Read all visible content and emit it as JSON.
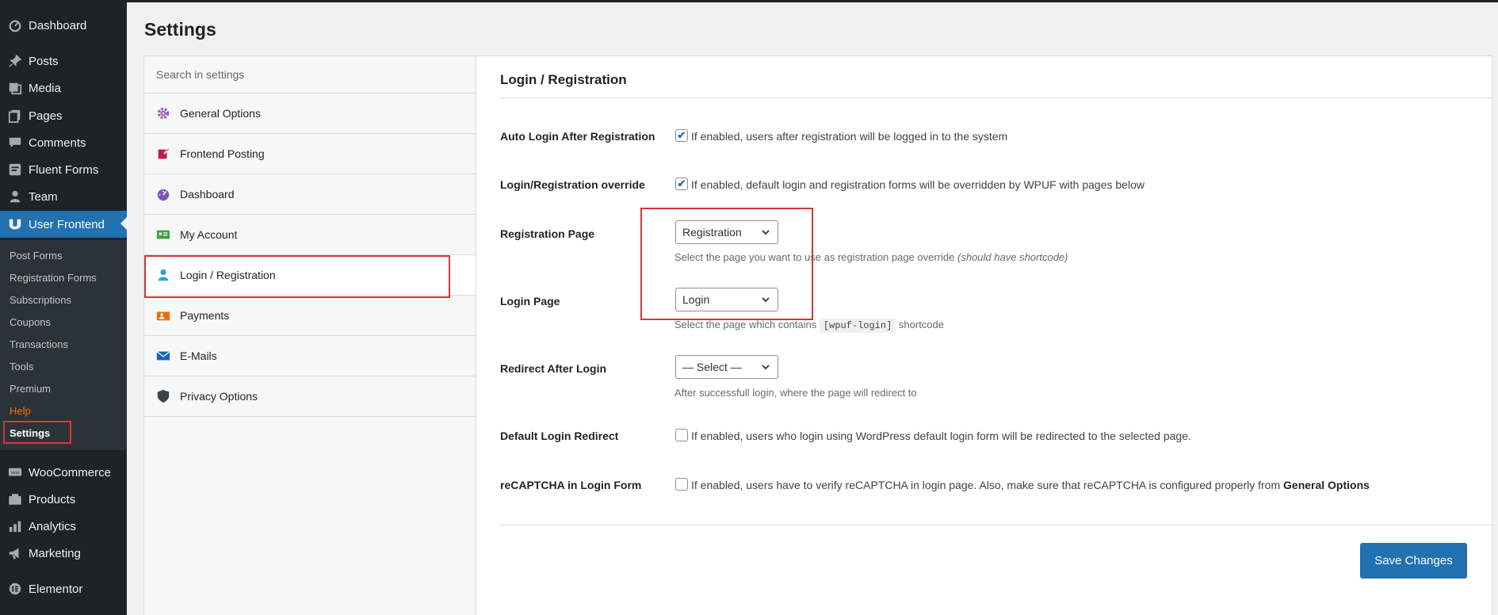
{
  "admin_menu": {
    "items": [
      {
        "label": "Dashboard",
        "icon": "dashboard-icon"
      },
      {
        "label": "Posts",
        "icon": "pin-icon"
      },
      {
        "label": "Media",
        "icon": "media-icon"
      },
      {
        "label": "Pages",
        "icon": "pages-icon"
      },
      {
        "label": "Comments",
        "icon": "comments-icon"
      },
      {
        "label": "Fluent Forms",
        "icon": "forms-icon"
      },
      {
        "label": "Team",
        "icon": "team-icon"
      },
      {
        "label": "User Frontend",
        "icon": "user-frontend-icon"
      },
      {
        "label": "WooCommerce",
        "icon": "woocommerce-icon"
      },
      {
        "label": "Products",
        "icon": "products-icon"
      },
      {
        "label": "Analytics",
        "icon": "analytics-icon"
      },
      {
        "label": "Marketing",
        "icon": "marketing-icon"
      },
      {
        "label": "Elementor",
        "icon": "elementor-icon"
      }
    ],
    "submenu": [
      "Post Forms",
      "Registration Forms",
      "Subscriptions",
      "Coupons",
      "Transactions",
      "Tools",
      "Premium",
      "Help",
      "Settings"
    ]
  },
  "page_title": "Settings",
  "settings_nav": {
    "search_placeholder": "Search in settings",
    "items": [
      {
        "label": "General Options",
        "icon": "gear-icon"
      },
      {
        "label": "Frontend Posting",
        "icon": "edit-icon"
      },
      {
        "label": "Dashboard",
        "icon": "dashboard-icon"
      },
      {
        "label": "My Account",
        "icon": "id-card-icon"
      },
      {
        "label": "Login / Registration",
        "icon": "user-icon"
      },
      {
        "label": "Payments",
        "icon": "payments-icon"
      },
      {
        "label": "E-Mails",
        "icon": "email-icon"
      },
      {
        "label": "Privacy Options",
        "icon": "shield-icon"
      }
    ]
  },
  "main": {
    "section_title": "Login / Registration",
    "auto_login": {
      "label": "Auto Login After Registration",
      "checked": true,
      "text": "If enabled, users after registration will be logged in to the system"
    },
    "override": {
      "label": "Login/Registration override",
      "checked": true,
      "text": "If enabled, default login and registration forms will be overridden by WPUF with pages below"
    },
    "registration_page": {
      "label": "Registration Page",
      "value": "Registration",
      "desc": "Select the page you want to use as registration page override",
      "desc_italic": "(should have shortcode)"
    },
    "login_page": {
      "label": "Login Page",
      "value": "Login",
      "desc_before": "Select the page which contains",
      "code": "[wpuf-login]",
      "desc_after": "shortcode"
    },
    "redirect_after_login": {
      "label": "Redirect After Login",
      "value": "— Select —",
      "desc": "After successfull login, where the page will redirect to"
    },
    "default_login_redirect": {
      "label": "Default Login Redirect",
      "checked": false,
      "text": "If enabled, users who login using WordPress default login form will be redirected to the selected page."
    },
    "recaptcha": {
      "label": "reCAPTCHA in Login Form",
      "checked": false,
      "text": "If enabled, users have to verify reCAPTCHA in login page. Also, make sure that reCAPTCHA is configured properly from",
      "text_bold": "General Options"
    },
    "save_label": "Save Changes"
  },
  "colors": {
    "accent": "#2271b1",
    "highlight_outline": "#d63638",
    "sidebar_bg": "#1d2327"
  }
}
